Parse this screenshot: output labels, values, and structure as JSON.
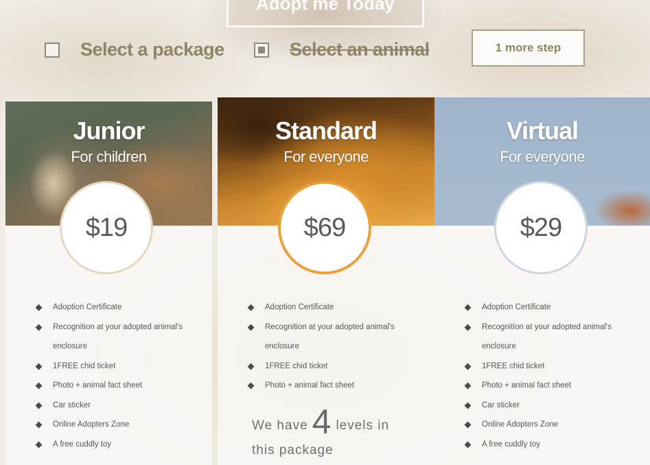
{
  "hero": {
    "cta_label": "Adopt me Today"
  },
  "steps": {
    "select_package": "Select a package",
    "select_animal": "Select an animal",
    "more_step": "1 more step"
  },
  "packages": [
    {
      "title": "Junior",
      "subtitle": "For children",
      "price": "$19",
      "features": [
        "Adoption Certificate",
        "Recognition at your adopted animal's",
        "enclosure",
        "1FREE chid ticket",
        "Photo + animal fact sheet",
        "Car sticker",
        "Online Adopters Zone",
        "A free cuddly toy"
      ]
    },
    {
      "title": "Standard",
      "subtitle": "For everyone",
      "price": "$69",
      "features": [
        "Adoption Certificate",
        "Recognition at your adopted animal's",
        "enclosure",
        "1FREE chid ticket",
        "Photo + animal fact sheet"
      ],
      "levels_text_before": "We have",
      "levels_number": "4",
      "levels_text_after": "levels in",
      "levels_text_line2": "this package"
    },
    {
      "title": "Virtual",
      "subtitle": "For everyone",
      "price": "$29",
      "features": [
        "Adoption Certificate",
        "Recognition at your adopted animal's",
        "enclosure",
        "1FREE chid ticket",
        "Photo + animal fact sheet",
        "Car sticker",
        "Online Adopters Zone",
        "A free cuddly toy"
      ]
    }
  ],
  "colors": {
    "accent": "#8d8566",
    "price_text": "#5a5a5a"
  }
}
